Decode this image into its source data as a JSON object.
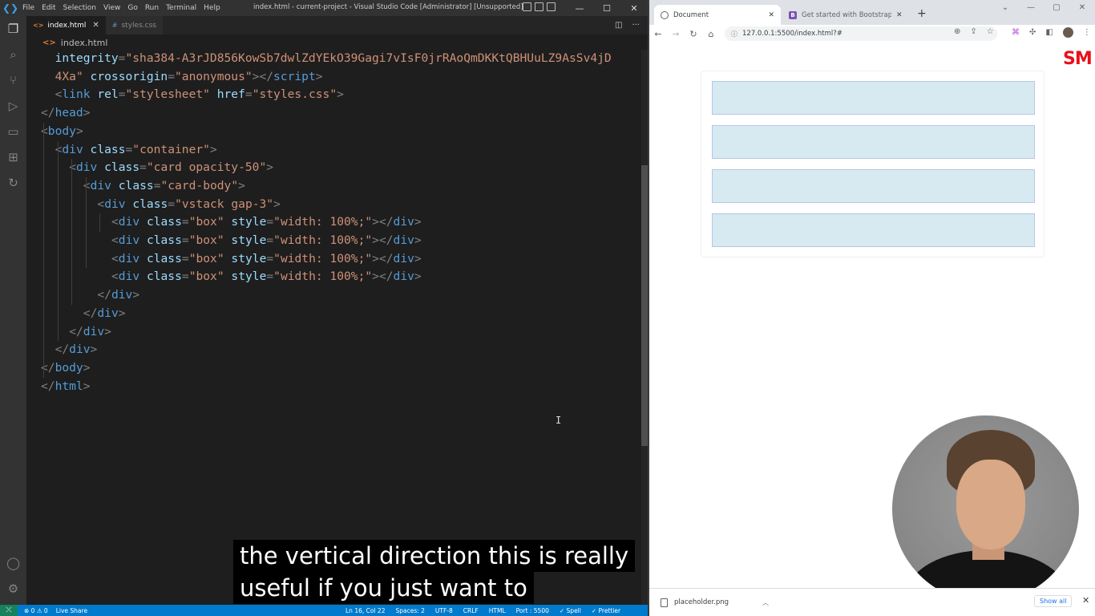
{
  "vscode": {
    "menu": [
      "File",
      "Edit",
      "Selection",
      "View",
      "Go",
      "Run",
      "Terminal",
      "Help"
    ],
    "window_title": "index.html - current-project - Visual Studio Code [Administrator] [Unsupported]",
    "tabs": [
      {
        "label": "index.html",
        "icon": "html-file-icon"
      },
      {
        "label": "styles.css",
        "icon": "css-file-icon"
      }
    ],
    "breadcrumb": "index.html",
    "code_lines": [
      {
        "indent": 1,
        "parts": [
          [
            "attr",
            "integrity"
          ],
          [
            "br",
            "="
          ],
          [
            "str",
            "\"sha384-A3rJD856KowSb7dwlZdYEkO39Gagi7vIsF0jrRAoQmDKKtQBHUuLZ9AsSv4jD"
          ]
        ]
      },
      {
        "indent": 1,
        "parts": [
          [
            "str",
            "4Xa\""
          ],
          [
            "br",
            " "
          ],
          [
            "attr",
            "crossorigin"
          ],
          [
            "br",
            "="
          ],
          [
            "str",
            "\"anonymous\""
          ],
          [
            "br",
            "></"
          ],
          [
            "tag",
            "script"
          ],
          [
            "br",
            ">"
          ]
        ]
      },
      {
        "indent": 1,
        "parts": [
          [
            "br",
            "<"
          ],
          [
            "tag",
            "link"
          ],
          [
            "br",
            " "
          ],
          [
            "attr",
            "rel"
          ],
          [
            "br",
            "="
          ],
          [
            "str",
            "\"stylesheet\""
          ],
          [
            "br",
            " "
          ],
          [
            "attr",
            "href"
          ],
          [
            "br",
            "="
          ],
          [
            "str",
            "\"styles.css\""
          ],
          [
            "br",
            ">"
          ]
        ]
      },
      {
        "indent": 0,
        "parts": [
          [
            "br",
            "</"
          ],
          [
            "tag",
            "head"
          ],
          [
            "br",
            ">"
          ]
        ]
      },
      {
        "indent": 0,
        "parts": [
          [
            "br",
            "<"
          ],
          [
            "tag",
            "body"
          ],
          [
            "br",
            ">"
          ]
        ]
      },
      {
        "indent": 1,
        "parts": [
          [
            "br",
            "<"
          ],
          [
            "tag",
            "div"
          ],
          [
            "br",
            " "
          ],
          [
            "attr",
            "class"
          ],
          [
            "br",
            "="
          ],
          [
            "str",
            "\"container\""
          ],
          [
            "br",
            ">"
          ]
        ]
      },
      {
        "indent": 2,
        "parts": [
          [
            "br",
            "<"
          ],
          [
            "tag",
            "div"
          ],
          [
            "br",
            " "
          ],
          [
            "attr",
            "class"
          ],
          [
            "br",
            "="
          ],
          [
            "str",
            "\"card opacity-50\""
          ],
          [
            "br",
            ">"
          ]
        ]
      },
      {
        "indent": 3,
        "parts": [
          [
            "br",
            "<"
          ],
          [
            "tag",
            "div"
          ],
          [
            "br",
            " "
          ],
          [
            "attr",
            "class"
          ],
          [
            "br",
            "="
          ],
          [
            "str",
            "\"card-body\""
          ],
          [
            "br",
            ">"
          ]
        ]
      },
      {
        "indent": 4,
        "parts": [
          [
            "br",
            "<"
          ],
          [
            "tag",
            "div"
          ],
          [
            "br",
            " "
          ],
          [
            "attr",
            "class"
          ],
          [
            "br",
            "="
          ],
          [
            "str",
            "\"vstack gap-3\""
          ],
          [
            "br",
            ">"
          ]
        ]
      },
      {
        "indent": 5,
        "parts": [
          [
            "br",
            "<"
          ],
          [
            "tag",
            "div"
          ],
          [
            "br",
            " "
          ],
          [
            "attr",
            "class"
          ],
          [
            "br",
            "="
          ],
          [
            "str",
            "\"box\""
          ],
          [
            "br",
            " "
          ],
          [
            "attr",
            "style"
          ],
          [
            "br",
            "="
          ],
          [
            "str",
            "\"width: 100%;\""
          ],
          [
            "br",
            "></"
          ],
          [
            "tag",
            "div"
          ],
          [
            "br",
            ">"
          ]
        ]
      },
      {
        "indent": 5,
        "parts": [
          [
            "br",
            "<"
          ],
          [
            "tag",
            "div"
          ],
          [
            "br",
            " "
          ],
          [
            "attr",
            "class"
          ],
          [
            "br",
            "="
          ],
          [
            "str",
            "\"box\""
          ],
          [
            "br",
            " "
          ],
          [
            "attr",
            "style"
          ],
          [
            "br",
            "="
          ],
          [
            "str",
            "\"width: 100%;\""
          ],
          [
            "br",
            "></"
          ],
          [
            "tag",
            "div"
          ],
          [
            "br",
            ">"
          ]
        ]
      },
      {
        "indent": 5,
        "parts": [
          [
            "br",
            "<"
          ],
          [
            "tag",
            "div"
          ],
          [
            "br",
            " "
          ],
          [
            "attr",
            "class"
          ],
          [
            "br",
            "="
          ],
          [
            "str",
            "\"box\""
          ],
          [
            "br",
            " "
          ],
          [
            "attr",
            "style"
          ],
          [
            "br",
            "="
          ],
          [
            "str",
            "\"width: 100%;\""
          ],
          [
            "br",
            "></"
          ],
          [
            "tag",
            "div"
          ],
          [
            "br",
            ">"
          ]
        ]
      },
      {
        "indent": 5,
        "parts": [
          [
            "br",
            "<"
          ],
          [
            "tag",
            "div"
          ],
          [
            "br",
            " "
          ],
          [
            "attr",
            "class"
          ],
          [
            "br",
            "="
          ],
          [
            "str",
            "\"box\""
          ],
          [
            "br",
            " "
          ],
          [
            "attr",
            "style"
          ],
          [
            "br",
            "="
          ],
          [
            "str",
            "\"width: 100%;\""
          ],
          [
            "br",
            "></"
          ],
          [
            "tag",
            "div"
          ],
          [
            "br",
            ">"
          ]
        ]
      },
      {
        "indent": 4,
        "parts": [
          [
            "br",
            "</"
          ],
          [
            "tag",
            "div"
          ],
          [
            "br",
            ">"
          ]
        ]
      },
      {
        "indent": 3,
        "parts": [
          [
            "br",
            "</"
          ],
          [
            "tag",
            "div"
          ],
          [
            "br",
            ">"
          ]
        ]
      },
      {
        "indent": 2,
        "parts": [
          [
            "br",
            "</"
          ],
          [
            "tag",
            "div"
          ],
          [
            "br",
            ">"
          ]
        ]
      },
      {
        "indent": 1,
        "parts": [
          [
            "br",
            "</"
          ],
          [
            "tag",
            "div"
          ],
          [
            "br",
            ">"
          ]
        ]
      },
      {
        "indent": 0,
        "parts": [
          [
            "br",
            "</"
          ],
          [
            "tag",
            "body"
          ],
          [
            "br",
            ">"
          ]
        ]
      },
      {
        "indent": 0,
        "parts": [
          [
            "br",
            "</"
          ],
          [
            "tag",
            "html"
          ],
          [
            "br",
            ">"
          ]
        ]
      }
    ],
    "status": {
      "problems": "⊗ 0 ⚠ 0",
      "live_share": "Live Share",
      "position": "Ln 16, Col 22",
      "spaces": "Spaces: 2",
      "encoding": "UTF-8",
      "eol": "CRLF",
      "language": "HTML",
      "port": "Port : 5500",
      "spell": "✓ Spell",
      "prettier": "✓ Prettier"
    }
  },
  "subtitle": {
    "line1": "the vertical direction this is really",
    "line2": "useful if you just want to"
  },
  "chrome": {
    "tabs": [
      {
        "label": "Document",
        "icon": "globe-icon"
      },
      {
        "label": "Get started with Bootstrap · Boo",
        "icon": "bootstrap-icon"
      }
    ],
    "url": "127.0.0.1:5500/index.html?#",
    "watermark": "SM",
    "box_count": 4,
    "download": {
      "filename": "placeholder.png",
      "show_all": "Show all"
    }
  }
}
